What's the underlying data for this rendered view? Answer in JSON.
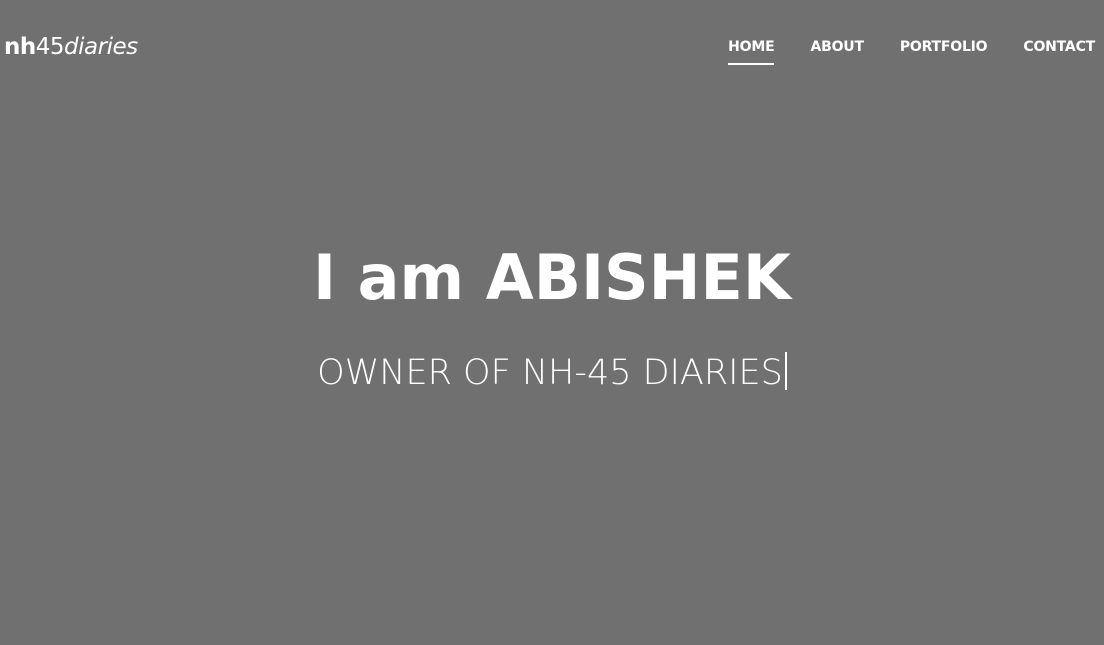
{
  "brand": {
    "part1": "nh",
    "part2": "45",
    "part3": "diaries"
  },
  "nav": {
    "items": [
      {
        "label": "HOME",
        "active": true
      },
      {
        "label": "ABOUT",
        "active": false
      },
      {
        "label": "PORTFOLIO",
        "active": false
      },
      {
        "label": "CONTACT",
        "active": false
      }
    ]
  },
  "hero": {
    "title": "I am ABISHEK",
    "subtitle": "OWNER OF NH-45 DIARIES"
  },
  "colors": {
    "background": "#707070",
    "text": "#ffffff"
  }
}
